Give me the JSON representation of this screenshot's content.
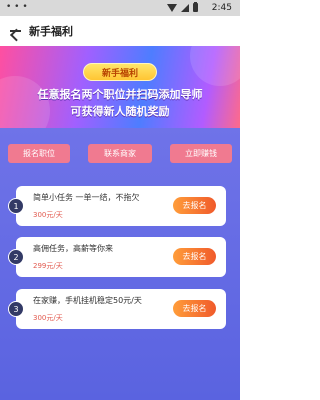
{
  "status_bar": {
    "time": "2:45",
    "left_dots": "• • •"
  },
  "app_bar": {
    "title": "新手福利"
  },
  "banner": {
    "badge": "新手福利",
    "line1": "任意报名两个职位并扫码添加导师",
    "line2": "可获得新人随机奖励"
  },
  "actions": [
    {
      "label": "报名职位"
    },
    {
      "label": "联系商家"
    },
    {
      "label": "立即赚钱"
    }
  ],
  "tasks": [
    {
      "index": "1",
      "title": "简单小任务 一单一结，不拖欠",
      "price": "300元/天",
      "button": "去报名"
    },
    {
      "index": "2",
      "title": "高佣任务，高薪等你来",
      "price": "299元/天",
      "button": "去报名"
    },
    {
      "index": "3",
      "title": "在家赚，手机挂机稳定50元/天",
      "price": "300元/天",
      "button": "去报名"
    }
  ],
  "colors": {
    "pill": "#f07a90",
    "background_blue": "#6068e4",
    "price": "#e25a4f",
    "button_orange": "#f0702f"
  }
}
